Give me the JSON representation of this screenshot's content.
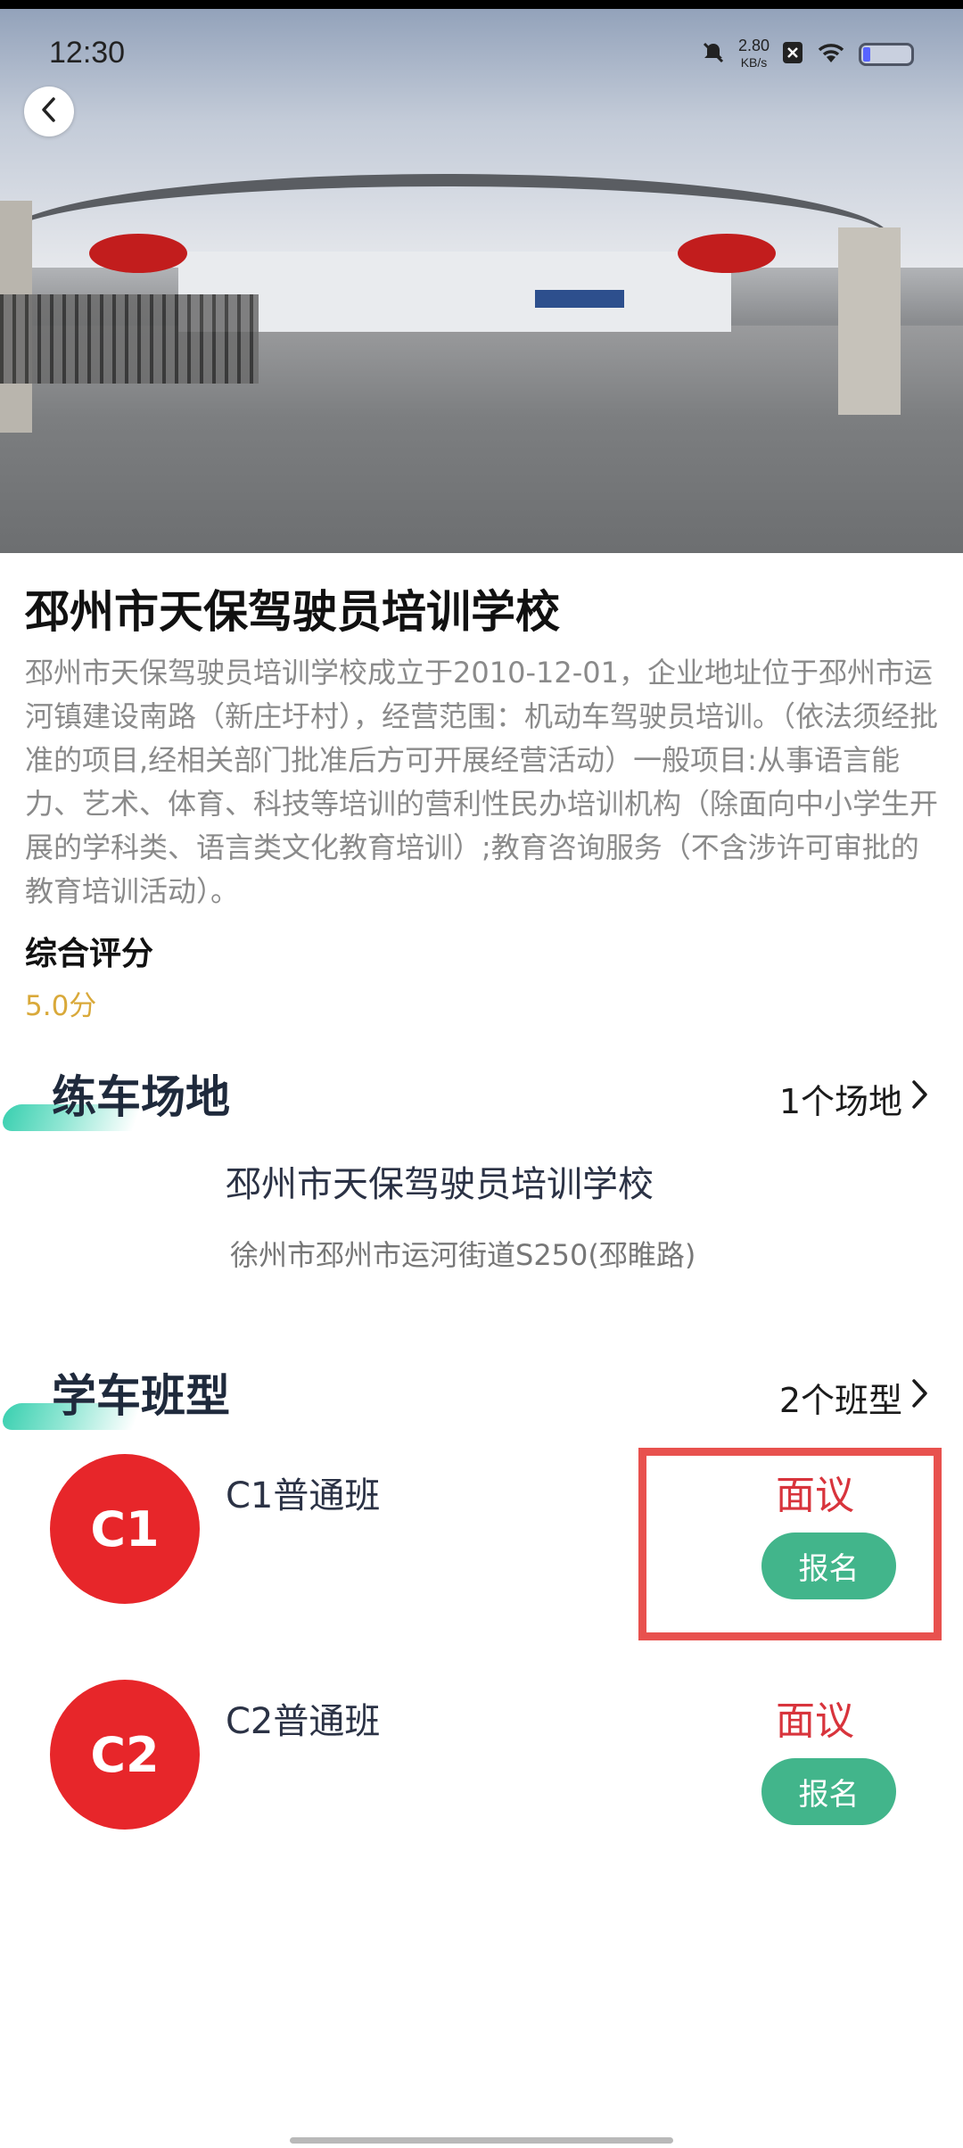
{
  "status_bar": {
    "time": "12:30",
    "speed_value": "2.80",
    "speed_unit": "KB/s"
  },
  "school": {
    "name": "邳州市天保驾驶员培训学校",
    "description": "邳州市天保驾驶员培训学校成立于2010-12-01，企业地址位于邳州市运河镇建设南路（新庄圩村），经营范围：机动车驾驶员培训。（依法须经批准的项目,经相关部门批准后方可开展经营活动）一般项目:从事语言能力、艺术、体育、科技等培训的营利性民办培训机构（除面向中小学生开展的学科类、语言类文化教育培训）;教育咨询服务（不含涉许可审批的教育培训活动）。",
    "rating_label": "综合评分",
    "rating_value": "5.0分"
  },
  "venue_section": {
    "title": "练车场地",
    "more": "1个场地",
    "venue_name": "邳州市天保驾驶员培训学校",
    "venue_address": "徐州市邳州市运河街道S250(邳睢路)"
  },
  "class_section": {
    "title": "学车班型",
    "more": "2个班型",
    "items": [
      {
        "badge": "C1",
        "name": "C1普通班",
        "price": "面议",
        "button": "报名"
      },
      {
        "badge": "C2",
        "name": "C2普通班",
        "price": "面议",
        "button": "报名"
      }
    ]
  },
  "colors": {
    "accent_green": "#42b58b",
    "price_red": "#d8343c",
    "badge_red": "#e7262a",
    "rating_gold": "#d9a93a",
    "highlight": "#e8514e"
  }
}
